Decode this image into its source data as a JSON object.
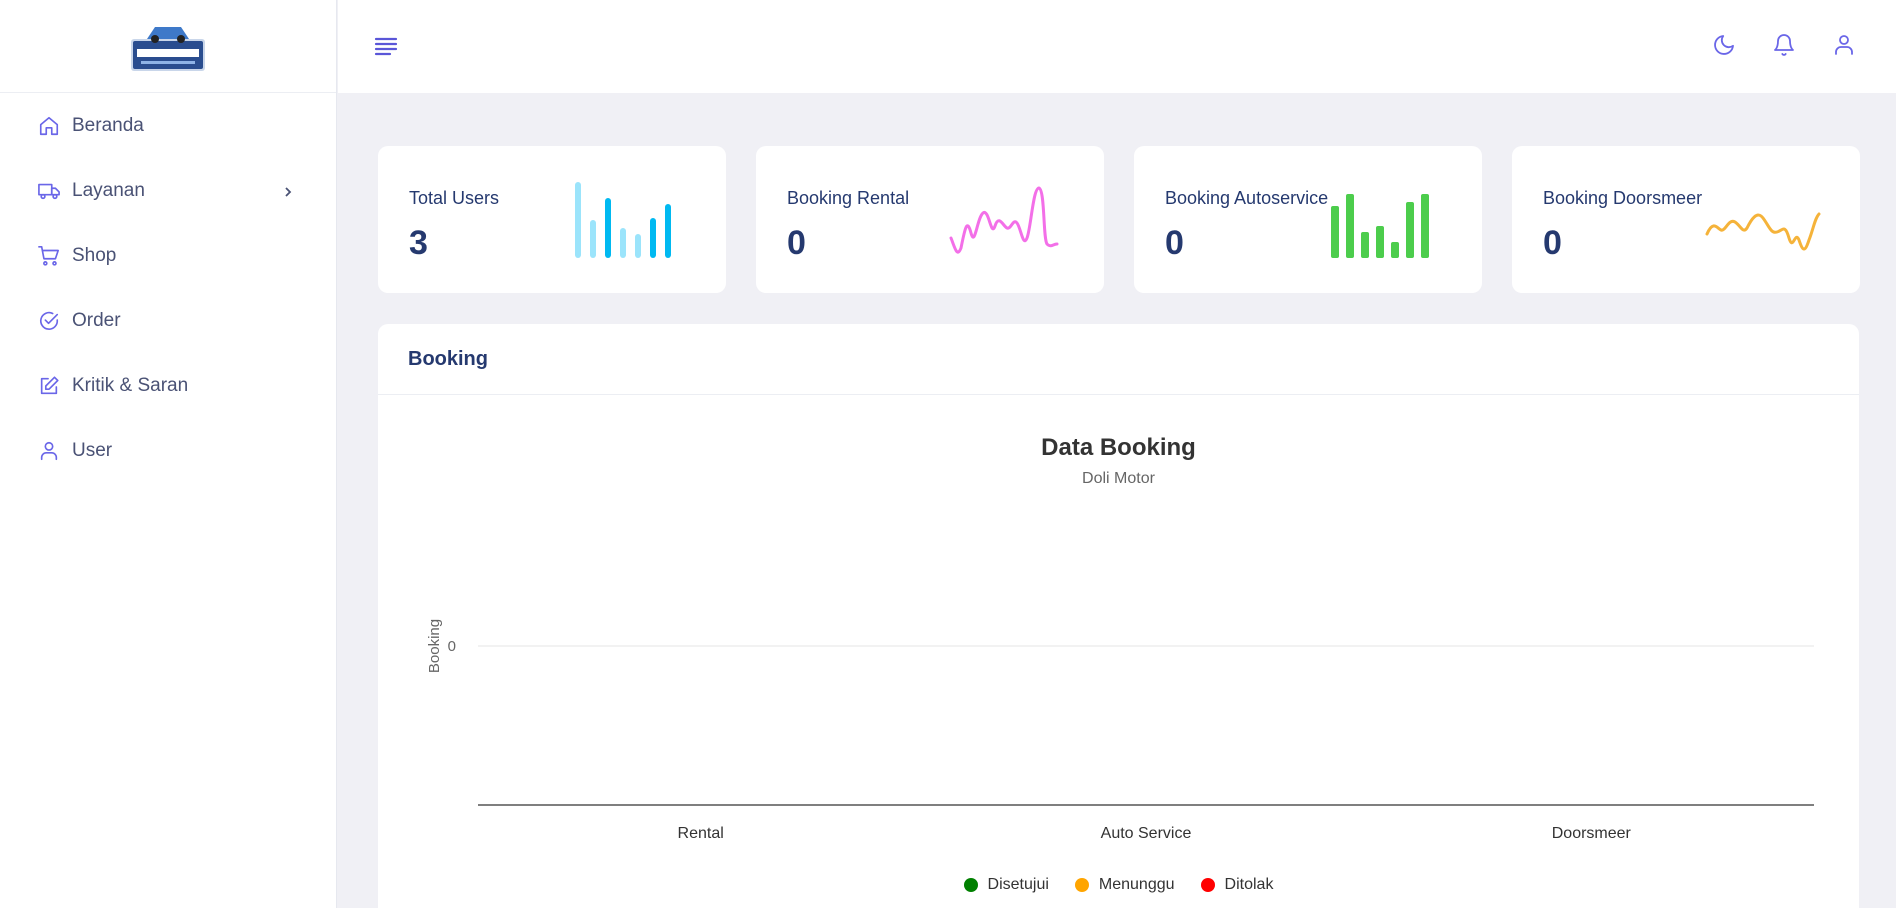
{
  "sidebar": {
    "items": [
      {
        "label": "Beranda",
        "icon": "home-icon"
      },
      {
        "label": "Layanan",
        "icon": "truck-icon"
      },
      {
        "label": "Shop",
        "icon": "cart-icon"
      },
      {
        "label": "Order",
        "icon": "check-circle-icon"
      },
      {
        "label": "Kritik & Saran",
        "icon": "edit-icon"
      },
      {
        "label": "User",
        "icon": "user-icon"
      }
    ]
  },
  "topbar": {
    "icons": [
      "menu-icon",
      "moon-icon",
      "bell-icon",
      "user-icon"
    ]
  },
  "stats": [
    {
      "label": "Total Users",
      "value": "3",
      "color": "#00b9f1"
    },
    {
      "label": "Booking Rental",
      "value": "0",
      "color": "#f36fe8"
    },
    {
      "label": "Booking Autoservice",
      "value": "0",
      "color": "#4ccd4c"
    },
    {
      "label": "Booking Doorsmeer",
      "value": "0",
      "color": "#f5b33a"
    }
  ],
  "panel": {
    "title": "Booking"
  },
  "chart_data": {
    "type": "bar",
    "title": "Data Booking",
    "subtitle": "Doli Motor",
    "xlabel": "",
    "ylabel": "Booking",
    "categories": [
      "Rental",
      "Auto Service",
      "Doorsmeer"
    ],
    "y_ticks": [
      "0"
    ],
    "series": [
      {
        "name": "Disetujui",
        "color": "#008000",
        "values": [
          0,
          0,
          0
        ]
      },
      {
        "name": "Menunggu",
        "color": "#ffa500",
        "values": [
          0,
          0,
          0
        ]
      },
      {
        "name": "Ditolak",
        "color": "#ff0000",
        "values": [
          0,
          0,
          0
        ]
      }
    ],
    "legend_position": "bottom",
    "grid": true
  }
}
